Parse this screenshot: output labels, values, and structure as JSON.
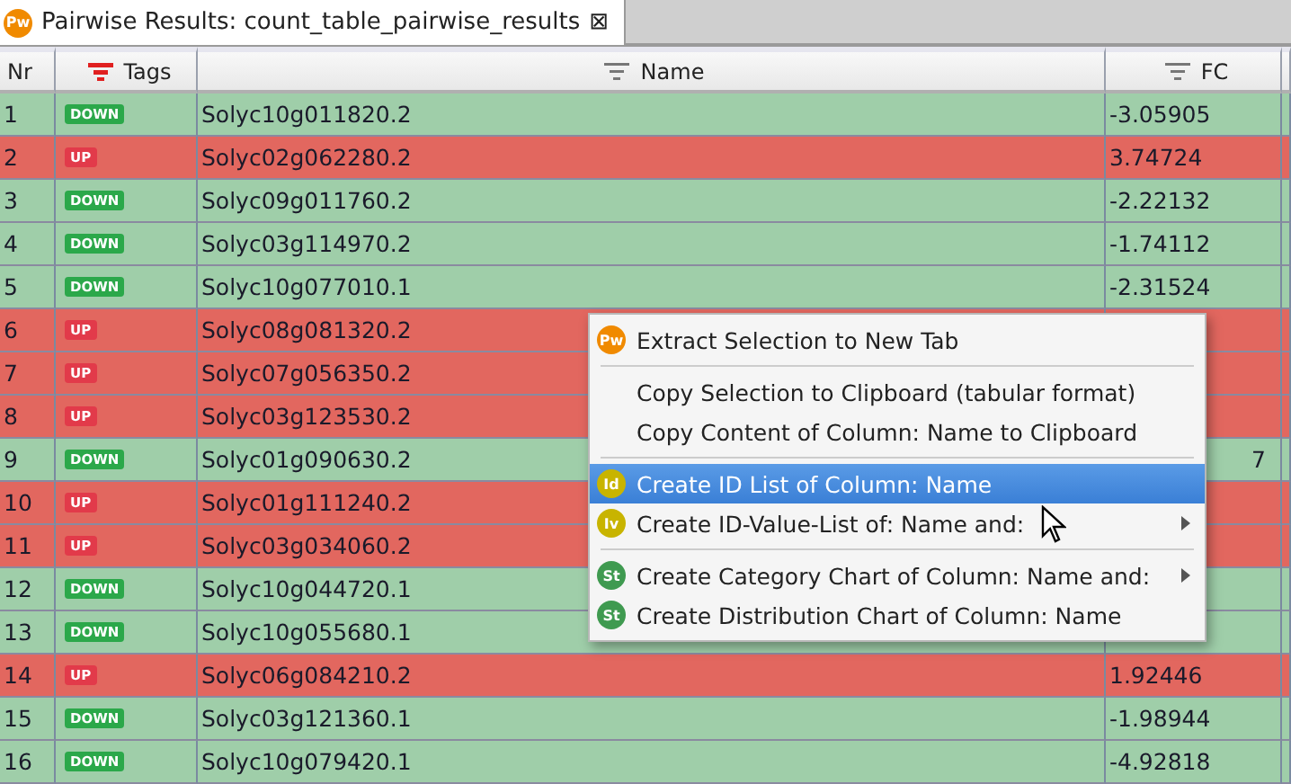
{
  "tab": {
    "icon": "Pw",
    "title": "Pairwise Results: count_table_pairwise_results",
    "close": "⊠"
  },
  "table": {
    "columns": [
      {
        "label": "Nr",
        "filter_icon": false
      },
      {
        "label": "Tags",
        "filter_icon": true,
        "filter_active": true
      },
      {
        "label": "Name",
        "filter_icon": true,
        "filter_active": false
      },
      {
        "label": "FC",
        "filter_icon": true,
        "filter_active": false
      }
    ],
    "rows": [
      {
        "nr": "1",
        "tag": "DOWN",
        "kind": "down",
        "name": "Solyc10g011820.2",
        "fc": "-3.05905"
      },
      {
        "nr": "2",
        "tag": "UP",
        "kind": "up",
        "name": "Solyc02g062280.2",
        "fc": "3.74724"
      },
      {
        "nr": "3",
        "tag": "DOWN",
        "kind": "down",
        "name": "Solyc09g011760.2",
        "fc": "-2.22132"
      },
      {
        "nr": "4",
        "tag": "DOWN",
        "kind": "down",
        "name": "Solyc03g114970.2",
        "fc": "-1.74112"
      },
      {
        "nr": "5",
        "tag": "DOWN",
        "kind": "down",
        "name": "Solyc10g077010.1",
        "fc": "-2.31524"
      },
      {
        "nr": "6",
        "tag": "UP",
        "kind": "up",
        "name": "Solyc08g081320.2"
      },
      {
        "nr": "7",
        "tag": "UP",
        "kind": "up",
        "name": "Solyc07g056350.2"
      },
      {
        "nr": "8",
        "tag": "UP",
        "kind": "up",
        "name": "Solyc03g123530.2"
      },
      {
        "nr": "9",
        "tag": "DOWN",
        "kind": "down",
        "name": "Solyc01g090630.2",
        "fc": "7",
        "fc_tail": true
      },
      {
        "nr": "10",
        "tag": "UP",
        "kind": "up",
        "name": "Solyc01g111240.2"
      },
      {
        "nr": "11",
        "tag": "UP",
        "kind": "up",
        "name": "Solyc03g034060.2"
      },
      {
        "nr": "12",
        "tag": "DOWN",
        "kind": "down",
        "name": "Solyc10g044720.1"
      },
      {
        "nr": "13",
        "tag": "DOWN",
        "kind": "down",
        "name": "Solyc10g055680.1"
      },
      {
        "nr": "14",
        "tag": "UP",
        "kind": "up",
        "name": "Solyc06g084210.2",
        "fc": "1.92446"
      },
      {
        "nr": "15",
        "tag": "DOWN",
        "kind": "down",
        "name": "Solyc03g121360.1",
        "fc": "-1.98944"
      },
      {
        "nr": "16",
        "tag": "DOWN",
        "kind": "down",
        "name": "Solyc10g079420.1",
        "fc": "-4.92818"
      }
    ]
  },
  "context_menu": {
    "items": [
      {
        "kind": "item",
        "icon": "Pw",
        "color": "#f08a00",
        "label": "Extract Selection to New Tab",
        "selected": false,
        "submenu": false
      },
      {
        "kind": "separator"
      },
      {
        "kind": "item",
        "label": "Copy Selection to Clipboard (tabular format)",
        "selected": false,
        "submenu": false
      },
      {
        "kind": "item",
        "label": "Copy Content of Column: Name to Clipboard",
        "selected": false,
        "submenu": false
      },
      {
        "kind": "separator"
      },
      {
        "kind": "item",
        "icon": "Id",
        "color": "#c8b400",
        "label": "Create ID List of Column: Name",
        "selected": true,
        "submenu": false
      },
      {
        "kind": "item",
        "icon": "Iv",
        "color": "#c8b400",
        "label": "Create ID-Value-List of: Name and:",
        "selected": false,
        "submenu": true
      },
      {
        "kind": "separator"
      },
      {
        "kind": "item",
        "icon": "St",
        "color": "#3f9a50",
        "label": "Create Category Chart of Column: Name and:",
        "selected": false,
        "submenu": true
      },
      {
        "kind": "item",
        "icon": "St",
        "color": "#3f9a50",
        "label": "Create Distribution Chart of Column: Name",
        "selected": false,
        "submenu": false
      }
    ]
  }
}
